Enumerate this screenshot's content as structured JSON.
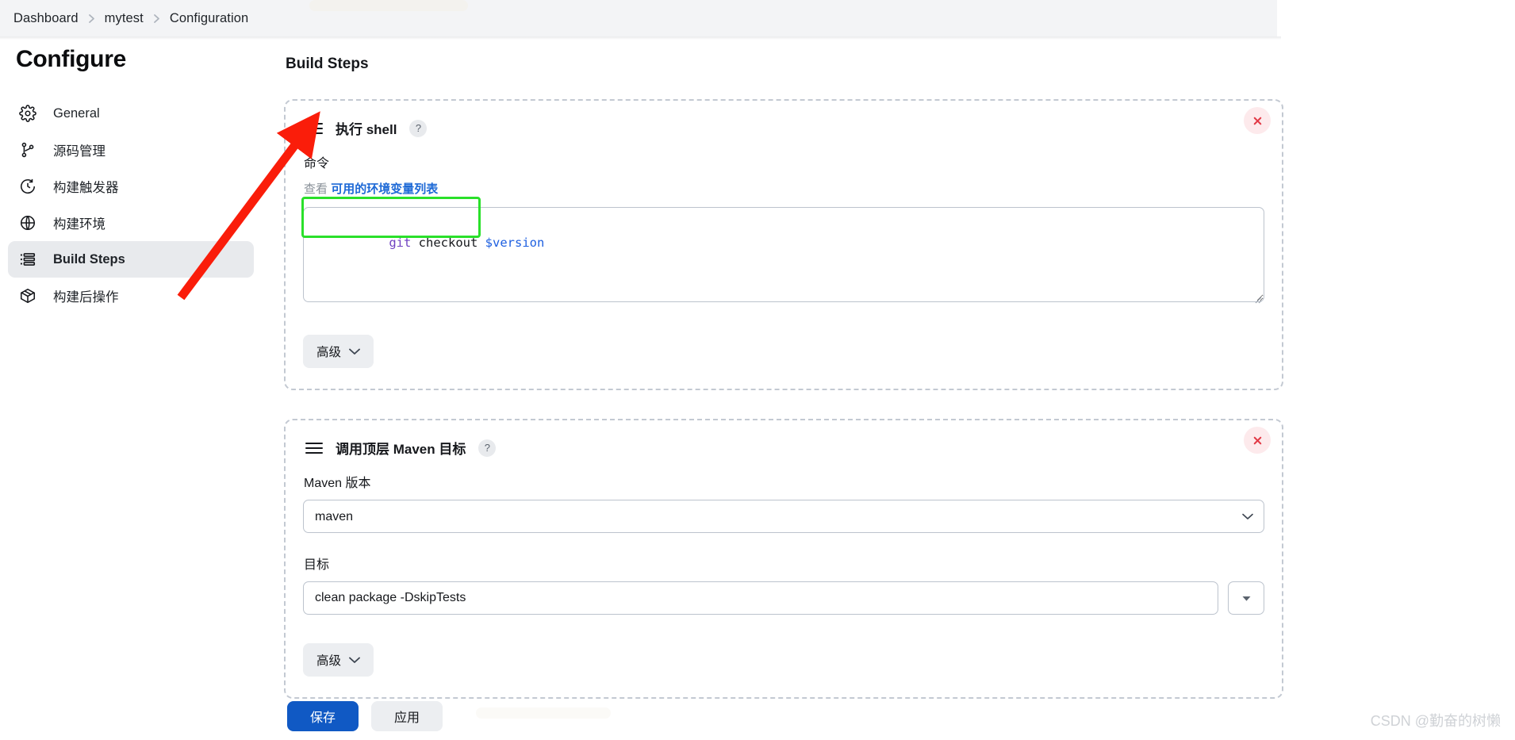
{
  "breadcrumb": {
    "items": [
      "Dashboard",
      "mytest",
      "Configuration"
    ]
  },
  "sidebar": {
    "title": "Configure",
    "items": [
      {
        "label": "General",
        "icon": "gear-icon",
        "active": false
      },
      {
        "label": "源码管理",
        "icon": "source-branch-icon",
        "active": false
      },
      {
        "label": "构建触发器",
        "icon": "clock-icon",
        "active": false
      },
      {
        "label": "构建环境",
        "icon": "globe-icon",
        "active": false
      },
      {
        "label": "Build Steps",
        "icon": "list-steps-icon",
        "active": true
      },
      {
        "label": "构建后操作",
        "icon": "package-icon",
        "active": false
      }
    ]
  },
  "main": {
    "title": "Build Steps",
    "steps": [
      {
        "title": "执行 shell",
        "help_label": "?",
        "close_label": "×",
        "command_label": "命令",
        "env_prefix": "查看",
        "env_link": "可用的环境变量列表",
        "command_tokens": [
          {
            "text": "git",
            "kind": "cmd"
          },
          {
            "text": " checkout ",
            "kind": "plain"
          },
          {
            "text": "$version",
            "kind": "var"
          }
        ],
        "command_value": "git checkout $version",
        "command_placeholder": "",
        "advanced_label": "高级"
      },
      {
        "title": "调用顶层 Maven 目标",
        "help_label": "?",
        "close_label": "×",
        "version_label": "Maven 版本",
        "version_value": "maven",
        "version_options": [
          "maven"
        ],
        "goal_label": "目标",
        "goal_value": "clean package -DskipTests",
        "goal_placeholder": "",
        "goal_dropdown_label": "▼",
        "advanced_label": "高级"
      }
    ]
  },
  "footer": {
    "save_label": "保存",
    "apply_label": "应用"
  },
  "watermark": "CSDN @勤奋的树懒",
  "colors": {
    "accent": "#1059c4",
    "link": "#1d69d6",
    "danger": "#e23b47",
    "annotation_red": "#fa1d0a",
    "annotation_green": "#2ae02a",
    "sidebar_active_bg": "#e8eaed"
  }
}
